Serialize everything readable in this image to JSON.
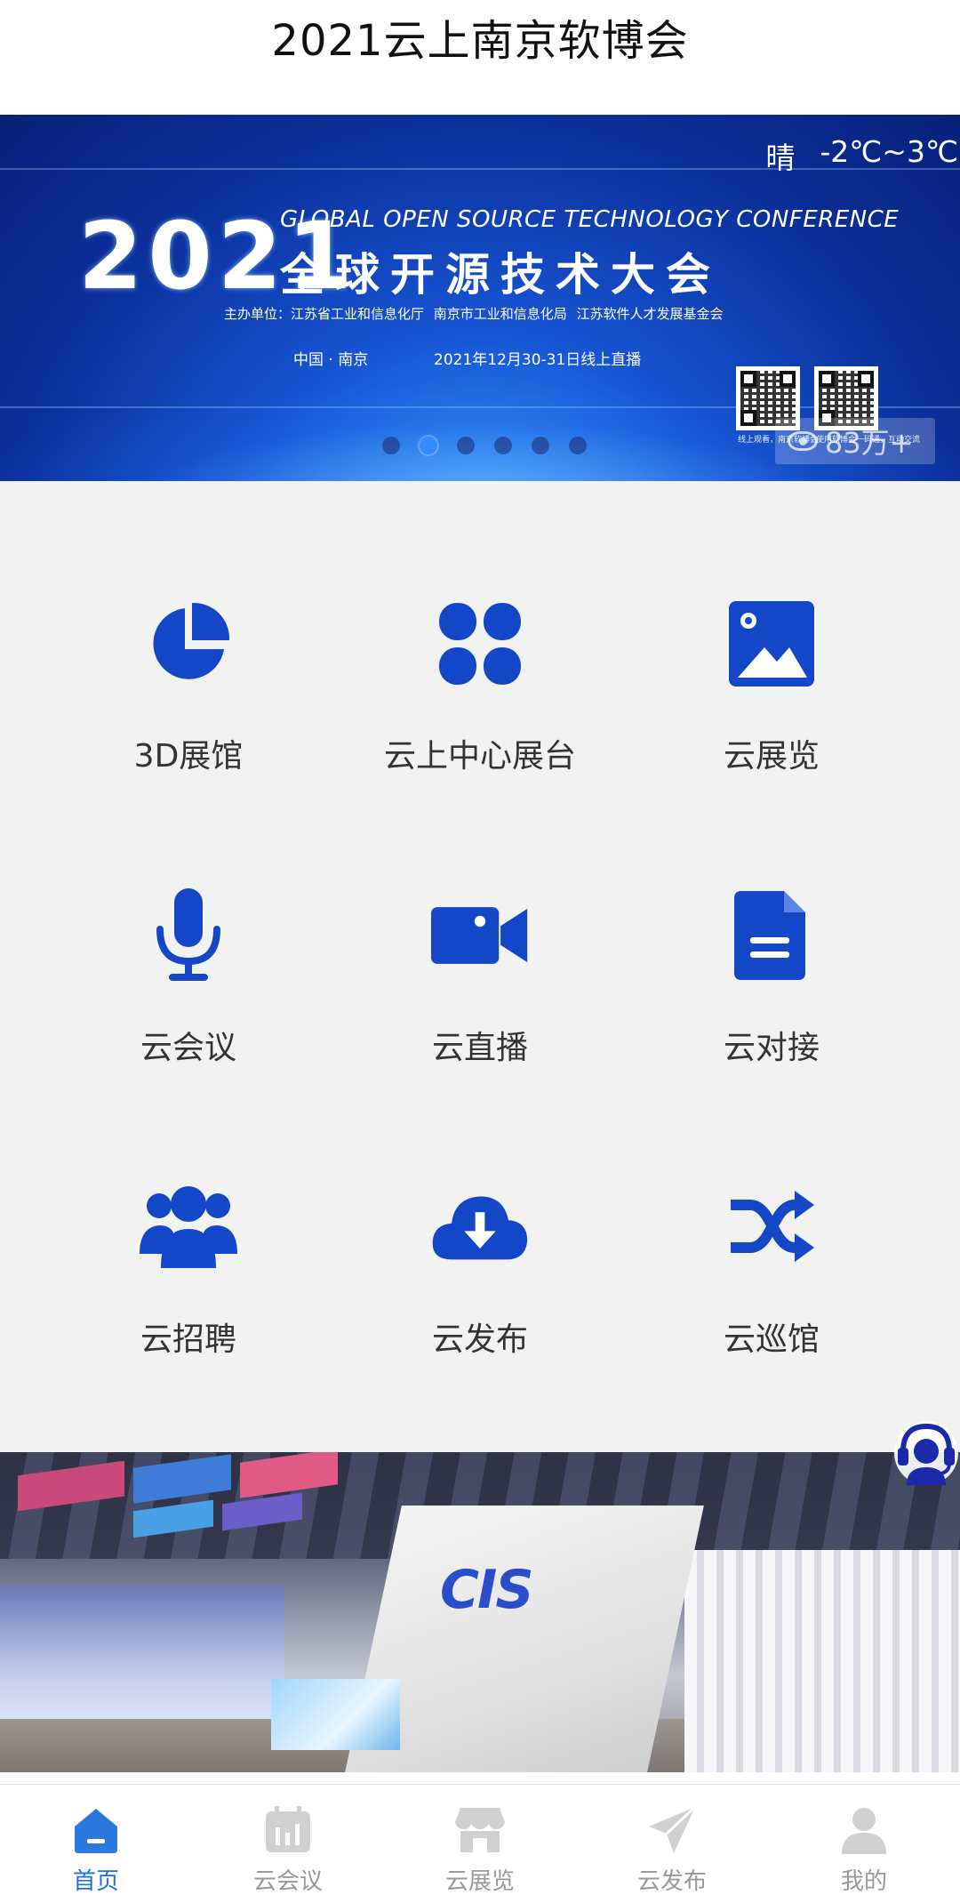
{
  "header": {
    "title": "2021云上南京软博会"
  },
  "banner": {
    "weather": {
      "condition": "晴",
      "temperature": "-2℃~3℃"
    },
    "year": "2021",
    "title_en": "GLOBAL OPEN SOURCE TECHNOLOGY CONFERENCE",
    "title_cn": "全球开源技术大会",
    "organizers": "主办单位：江苏省工业和信息化厅   南京市工业和信息化局   江苏软件人才发展基金会",
    "venue": "中国 · 南京",
    "date": "2021年12月30-31日线上直播",
    "qr_captions": [
      "线上观看，南京软博会",
      "使用软博会一码通，互动交流"
    ],
    "views": "83万+",
    "carousel": {
      "count": 6,
      "active_index": 2
    }
  },
  "grid": {
    "items": [
      {
        "label": "3D展馆",
        "icon": "pie-chart-icon"
      },
      {
        "label": "云上中心展台",
        "icon": "four-blocks-icon"
      },
      {
        "label": "云展览",
        "icon": "image-icon"
      },
      {
        "label": "云会议",
        "icon": "microphone-icon"
      },
      {
        "label": "云直播",
        "icon": "video-camera-icon"
      },
      {
        "label": "云对接",
        "icon": "document-icon"
      },
      {
        "label": "云招聘",
        "icon": "users-icon"
      },
      {
        "label": "云发布",
        "icon": "cloud-download-icon"
      },
      {
        "label": "云巡馆",
        "icon": "shuffle-icon"
      }
    ],
    "icon_color": "#1347c7"
  },
  "photo": {
    "logo": "CIS"
  },
  "tabbar": {
    "items": [
      {
        "label": "首页",
        "icon": "home-icon",
        "active": true
      },
      {
        "label": "云会议",
        "icon": "calendar-icon",
        "active": false
      },
      {
        "label": "云展览",
        "icon": "store-icon",
        "active": false
      },
      {
        "label": "云发布",
        "icon": "send-icon",
        "active": false
      },
      {
        "label": "我的",
        "icon": "user-icon",
        "active": false
      }
    ],
    "active_color": "#1e72d9",
    "inactive_color": "#999999"
  }
}
